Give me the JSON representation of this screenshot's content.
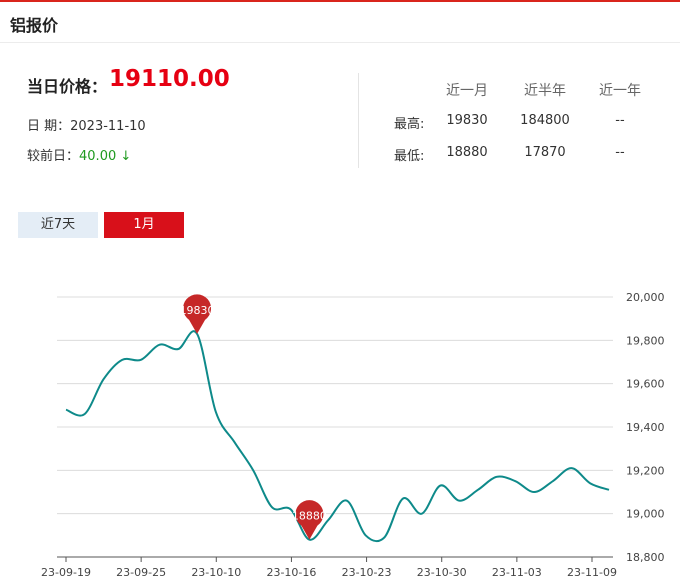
{
  "header": {
    "title": "铝报价"
  },
  "summary": {
    "today_label": "当日价格：",
    "today_price": "19110.00",
    "date_label": "日 期：",
    "date_value": "2023-11-10",
    "change_label": "较前日：",
    "change_value": "40.00 ↓"
  },
  "stats": {
    "columns": [
      "近一月",
      "近半年",
      "近一年"
    ],
    "rows": [
      {
        "label": "最高:",
        "values": [
          "19830",
          "184800",
          "--"
        ]
      },
      {
        "label": "最低:",
        "values": [
          "18880",
          "17870",
          "--"
        ]
      }
    ]
  },
  "tabs": [
    {
      "label": "近7天",
      "active": false
    },
    {
      "label": "1月",
      "active": true
    }
  ],
  "colors": {
    "accent": "#d8101a",
    "line": "#0e8a8a",
    "marker": "#c62828",
    "down": "#1f9a1f"
  },
  "chart_data": {
    "type": "line",
    "x_tick_labels": [
      "23-09-19",
      "23-09-25",
      "23-10-10",
      "23-10-16",
      "23-10-23",
      "23-10-30",
      "23-11-03",
      "23-11-09"
    ],
    "y_ticks": [
      18800,
      19000,
      19200,
      19400,
      19600,
      19800,
      20000
    ],
    "y_tick_labels": [
      "18,800",
      "19,000",
      "19,200",
      "19,400",
      "19,600",
      "19,800",
      "20,000"
    ],
    "ylim": [
      18800,
      20000
    ],
    "grid": true,
    "series": [
      {
        "values": [
          19480,
          19460,
          19620,
          19710,
          19710,
          19780,
          19760,
          19830,
          19470,
          19330,
          19200,
          19030,
          19020,
          18880,
          18970,
          19060,
          18900,
          18890,
          19070,
          19000,
          19130,
          19060,
          19110,
          19170,
          19150,
          19100,
          19150,
          19210,
          19140,
          19110
        ]
      }
    ],
    "annotations": [
      {
        "label": "19830",
        "index": 7,
        "value": 19830,
        "type": "max"
      },
      {
        "label": "18880",
        "index": 13,
        "value": 18880,
        "type": "min"
      }
    ]
  }
}
